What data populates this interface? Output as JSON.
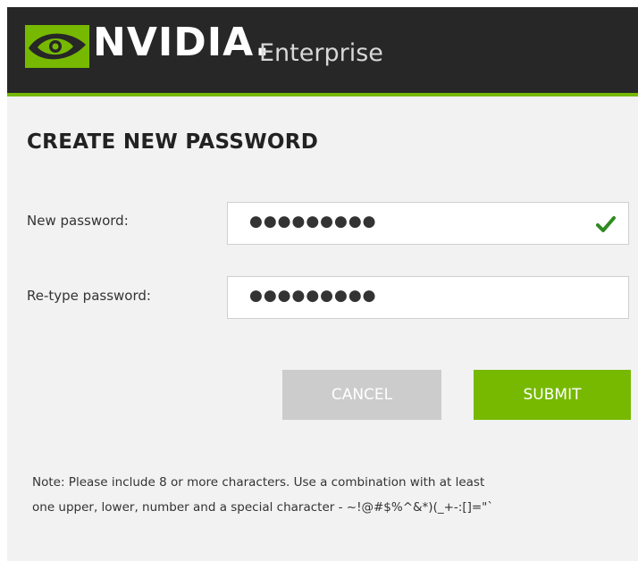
{
  "header": {
    "brand": "NVIDIA.",
    "product": "Enterprise"
  },
  "form": {
    "title": "CREATE NEW PASSWORD",
    "new_password_label": "New password:",
    "new_password_value": "●●●●●●●●●",
    "retype_password_label": "Re-type password:",
    "retype_password_value": "●●●●●●●●●"
  },
  "buttons": {
    "cancel_label": "CANCEL",
    "submit_label": "SUBMIT"
  },
  "note": {
    "line1": "Note: Please include 8 or more characters. Use a combination with at least",
    "line2": "one upper, lower, number and a special character - ~!@#$%^&*)(_+-:[]=\"`"
  },
  "colors": {
    "brand_green": "#76b900",
    "header_bg": "#272727",
    "check_green": "#2e8b1f"
  },
  "icons": {
    "logo": "nvidia-eye-logo",
    "valid": "checkmark-icon"
  }
}
